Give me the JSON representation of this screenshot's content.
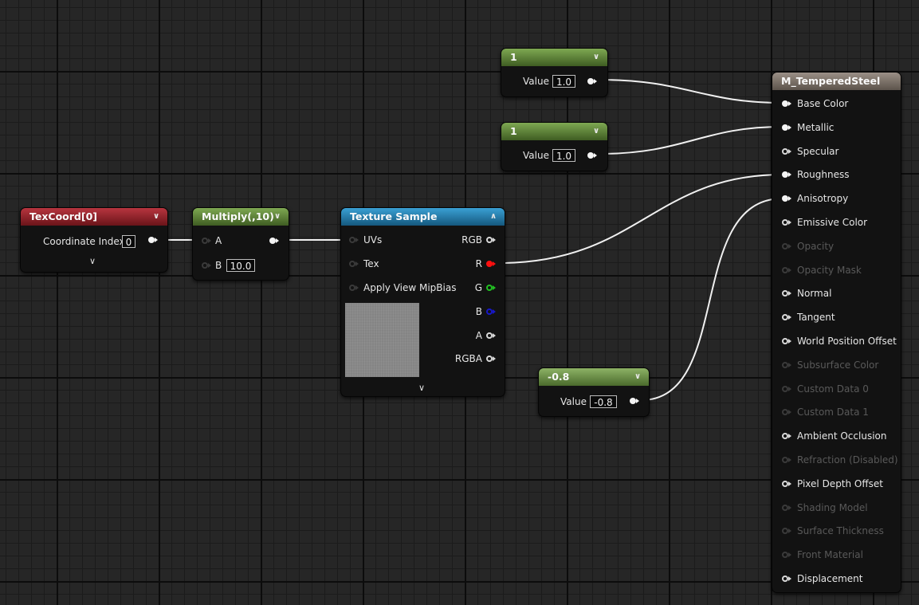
{
  "nodes": {
    "constant_top": {
      "title": "1",
      "value_label": "Value",
      "value": "1.0"
    },
    "constant_mid": {
      "title": "1",
      "value_label": "Value",
      "value": "1.0"
    },
    "constant_neg": {
      "title": "-0.8",
      "value_label": "Value",
      "value": "-0.8"
    },
    "texcoord": {
      "title": "TexCoord[0]",
      "coord_label": "Coordinate Index",
      "coord_value": "0"
    },
    "multiply": {
      "title": "Multiply(,10)",
      "input_a": "A",
      "input_b": "B",
      "b_value": "10.0"
    },
    "texture_sample": {
      "title": "Texture Sample",
      "inputs": [
        "UVs",
        "Tex",
        "Apply View MipBias"
      ],
      "outputs": [
        "RGB",
        "R",
        "G",
        "B",
        "A",
        "RGBA"
      ]
    },
    "material": {
      "title": "M_TemperedSteel",
      "pins": [
        {
          "label": "Base Color",
          "state": "connected"
        },
        {
          "label": "Metallic",
          "state": "connected"
        },
        {
          "label": "Specular",
          "state": "enabled"
        },
        {
          "label": "Roughness",
          "state": "connected"
        },
        {
          "label": "Anisotropy",
          "state": "connected"
        },
        {
          "label": "Emissive Color",
          "state": "enabled"
        },
        {
          "label": "Opacity",
          "state": "disabled"
        },
        {
          "label": "Opacity Mask",
          "state": "disabled"
        },
        {
          "label": "Normal",
          "state": "enabled"
        },
        {
          "label": "Tangent",
          "state": "enabled"
        },
        {
          "label": "World Position Offset",
          "state": "enabled"
        },
        {
          "label": "Subsurface Color",
          "state": "disabled"
        },
        {
          "label": "Custom Data 0",
          "state": "disabled"
        },
        {
          "label": "Custom Data 1",
          "state": "disabled"
        },
        {
          "label": "Ambient Occlusion",
          "state": "enabled"
        },
        {
          "label": "Refraction (Disabled)",
          "state": "disabled"
        },
        {
          "label": "Pixel Depth Offset",
          "state": "enabled"
        },
        {
          "label": "Shading Model",
          "state": "disabled"
        },
        {
          "label": "Surface Thickness",
          "state": "disabled"
        },
        {
          "label": "Front Material",
          "state": "disabled"
        },
        {
          "label": "Displacement",
          "state": "enabled"
        }
      ]
    }
  },
  "icons": {
    "collapse": "chevron-down-icon",
    "expand": "chevron-up-icon",
    "pin": "exec-pin-icon"
  },
  "colors": {
    "canvas": "#262626",
    "texcoord_header": "#8a2229",
    "constant_header": "#5c7f34",
    "texture_header": "#1f75a6",
    "material_header": "#776c62",
    "r_pin": "#ff1010",
    "g_pin": "#22c022",
    "b_pin": "#1818c8"
  }
}
